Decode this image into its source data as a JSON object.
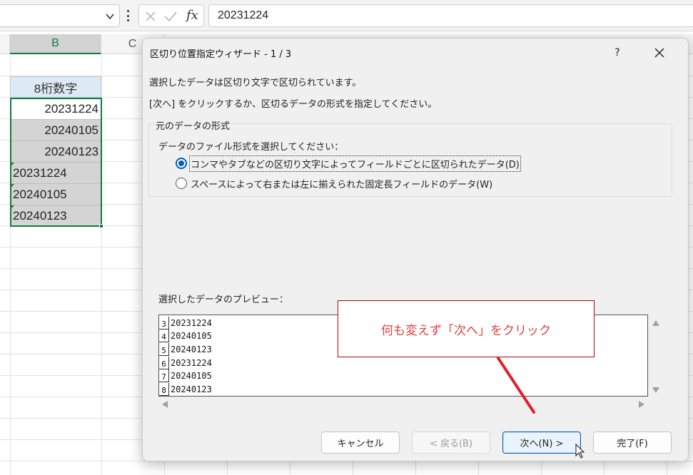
{
  "formula_bar": {
    "formula_value": "20231224"
  },
  "grid": {
    "column_headers": [
      "B",
      "C"
    ],
    "cells": [
      {
        "text": "8桁数字",
        "kind": "header"
      },
      {
        "text": "20231224",
        "kind": "num"
      },
      {
        "text": "20240105",
        "kind": "num"
      },
      {
        "text": "20240123",
        "kind": "num"
      },
      {
        "text": "20231224",
        "kind": "txt"
      },
      {
        "text": "20240105",
        "kind": "txt"
      },
      {
        "text": "20240123",
        "kind": "txt"
      }
    ]
  },
  "dialog": {
    "title": "区切り位置指定ウィザード - 1 / 3",
    "help_label": "?",
    "line1": "選択したデータは区切り文字で区切られています。",
    "line2": "[次へ] をクリックするか、区切るデータの形式を指定してください。",
    "group_label": "元のデータの形式",
    "group_prompt": "データのファイル形式を選択してください：",
    "radio_delimited": {
      "label": "コンマやタブなどの区切り文字によってフィールドごとに区切られたデータ(D)",
      "checked": true
    },
    "radio_fixed": {
      "label": "スペースによって右または左に揃えられた固定長フィールドのデータ(W)",
      "checked": false
    },
    "preview_label": "選択したデータのプレビュー：",
    "preview_rows": [
      {
        "n": "3",
        "v": "20231224"
      },
      {
        "n": "4",
        "v": "20240105"
      },
      {
        "n": "5",
        "v": "20240123"
      },
      {
        "n": "6",
        "v": "20231224"
      },
      {
        "n": "7",
        "v": "20240105"
      },
      {
        "n": "8",
        "v": "20240123"
      }
    ],
    "buttons": {
      "cancel": "キャンセル",
      "back": "< 戻る(B)",
      "next": "次へ(N) >",
      "finish": "完了(F)"
    }
  },
  "annotation": {
    "callout_text": "何も変えず「次へ」をクリック",
    "color": "#e04040"
  },
  "colors": {
    "excel_green": "#107c41",
    "selected_fill": "#d4d4d4",
    "header_fill": "#dde9f5",
    "accent_blue": "#005fb8"
  }
}
